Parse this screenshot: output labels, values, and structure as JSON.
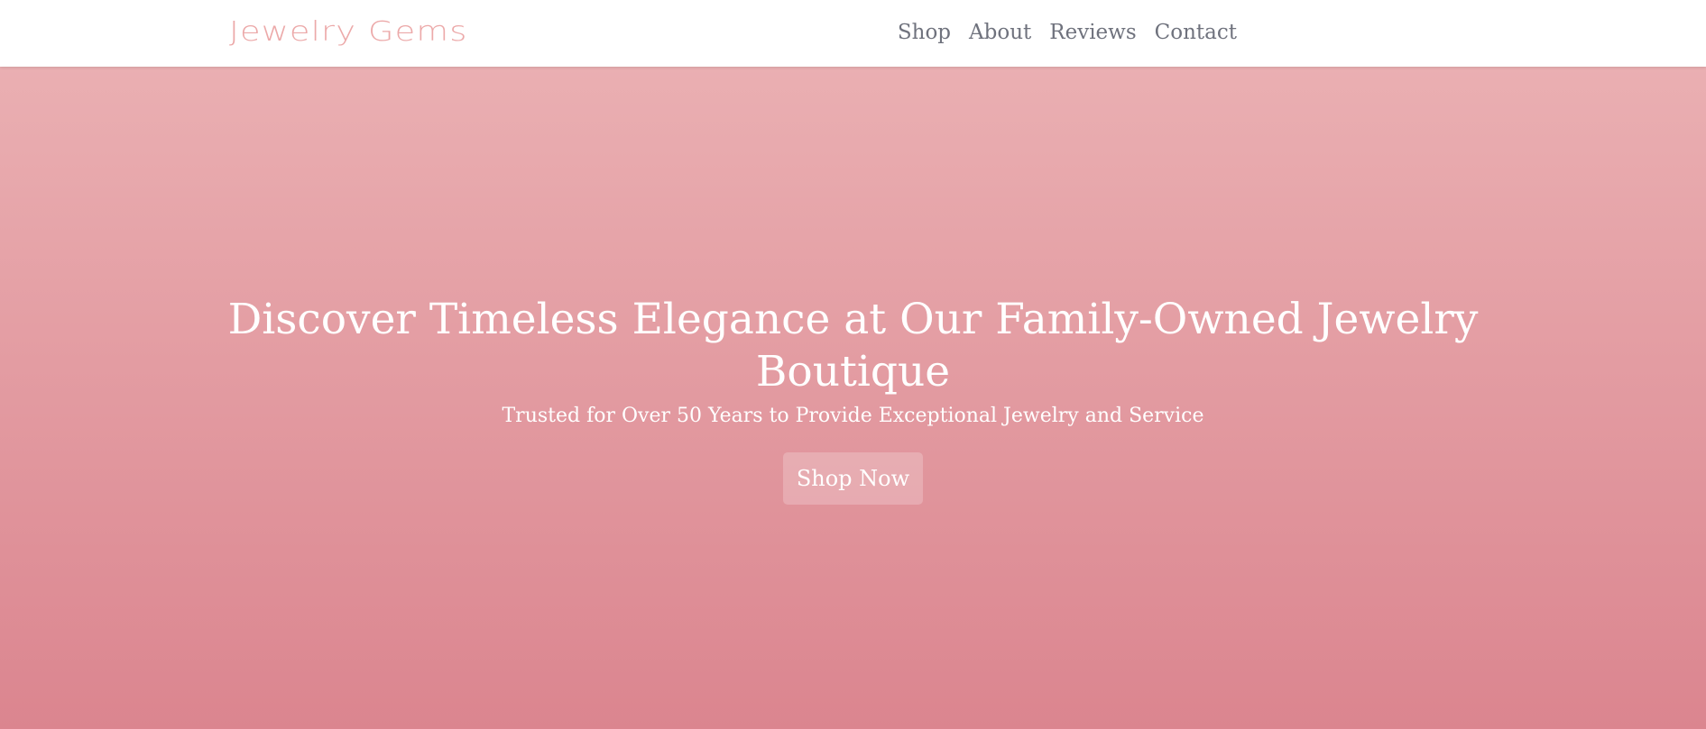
{
  "header": {
    "logo": "Jewelry Gems",
    "nav": [
      {
        "label": "Shop"
      },
      {
        "label": "About"
      },
      {
        "label": "Reviews"
      },
      {
        "label": "Contact"
      }
    ]
  },
  "hero": {
    "title": "Discover Timeless Elegance at Our Family-Owned Jewelry Boutique",
    "subtitle": "Trusted for Over 50 Years to Provide Exceptional Jewelry and Service",
    "cta_label": "Shop Now"
  },
  "colors": {
    "logo": "#eca9a9",
    "nav_text": "#6f727d",
    "hero_top": "#eaafb2",
    "hero_bottom": "#db858f",
    "hero_text": "#ffffff"
  }
}
